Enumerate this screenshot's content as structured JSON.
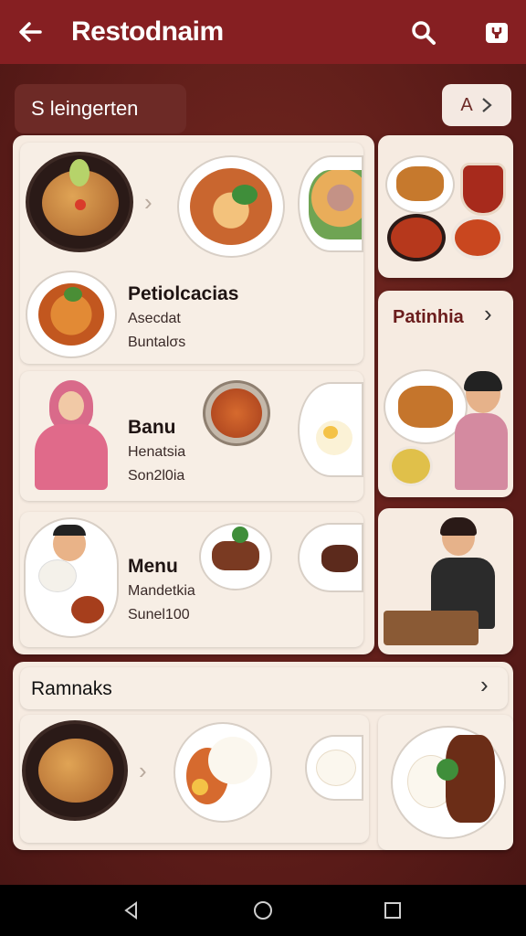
{
  "app_bar": {
    "title": "Restodnaim",
    "back_icon": "arrow-left-icon",
    "search_icon": "search-icon",
    "cart_icon": "bag-icon"
  },
  "filter_chip": {
    "label": "S leingerten"
  },
  "filter_button": {
    "label": "A",
    "icon": "chevron-right-icon"
  },
  "cards": [
    {
      "name": "Petiolcacias",
      "line1": "Asecdat",
      "line2": "Buntalσs"
    },
    {
      "name": "Banu",
      "line1": "Henatsia",
      "line2": "Son2l0ia"
    },
    {
      "name": "Menu",
      "line1": "Mandetkia",
      "line2": "Sunel100"
    }
  ],
  "side_panel": {
    "title": "Patinhia"
  },
  "bottom_section": {
    "title": "Ramnaks"
  },
  "colors": {
    "primary": "#861f22",
    "background": "#5e1a1a",
    "card": "#f7eee5",
    "accent_text": "#6b1d1d"
  }
}
